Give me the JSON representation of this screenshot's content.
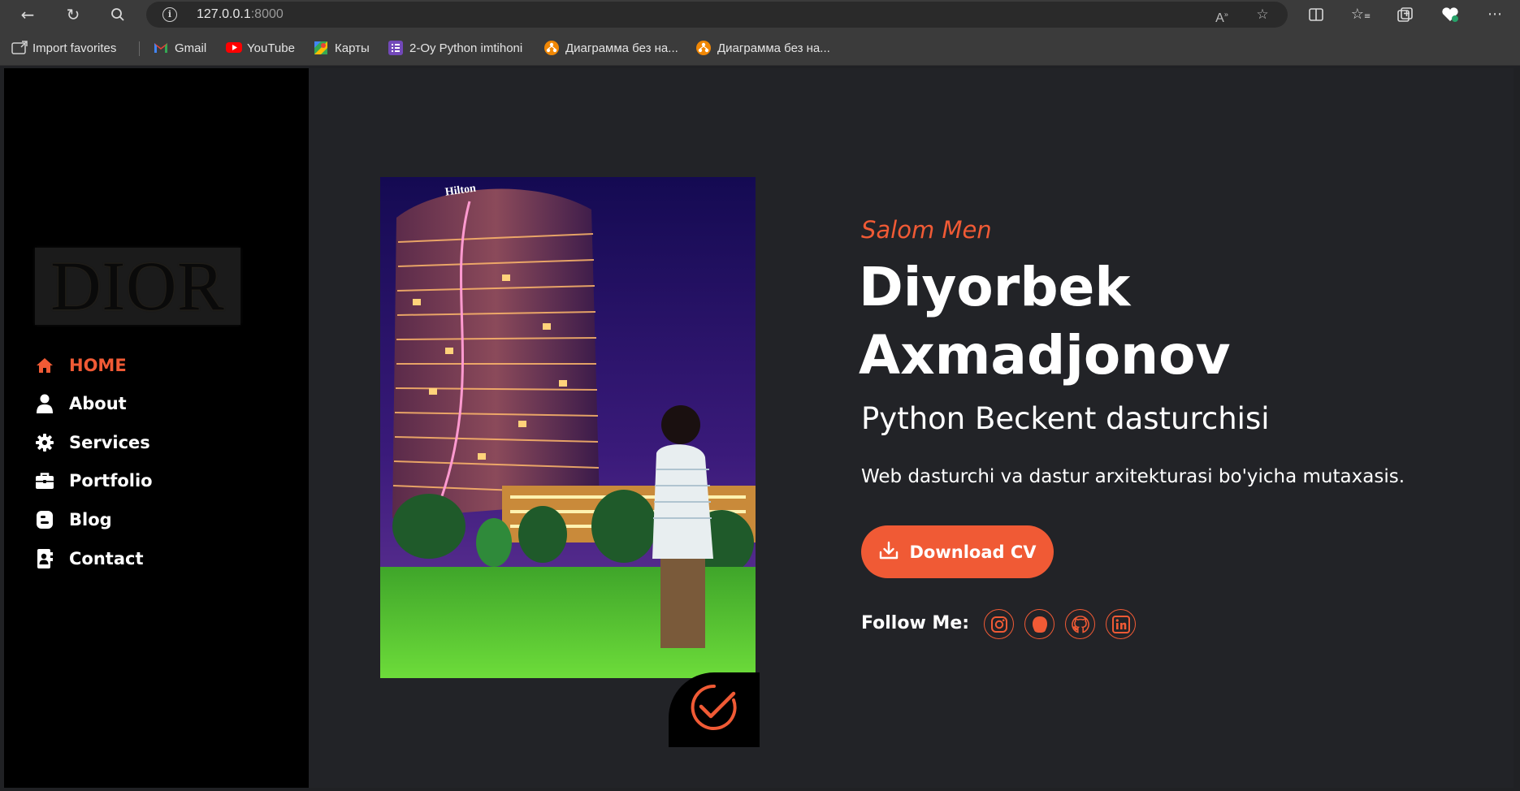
{
  "browser": {
    "url_host": "127.0.0.1",
    "url_port": ":8000",
    "bookmarks": [
      {
        "label": "Import favorites",
        "icon": "import-icon"
      },
      {
        "label": "Gmail",
        "icon": "gmail-icon"
      },
      {
        "label": "YouTube",
        "icon": "youtube-icon"
      },
      {
        "label": "Карты",
        "icon": "maps-icon"
      },
      {
        "label": "2-Oy Python imtihoni",
        "icon": "forms-icon"
      },
      {
        "label": "Диаграмма без на...",
        "icon": "diagram-icon"
      },
      {
        "label": "Диаграмма без на...",
        "icon": "diagram-icon"
      }
    ]
  },
  "sidebar": {
    "logo_text": "DIOR",
    "menu": [
      {
        "label": "HOME",
        "icon": "home-icon",
        "active": true
      },
      {
        "label": "About",
        "icon": "user-icon",
        "active": false
      },
      {
        "label": "Services",
        "icon": "gear-icon",
        "active": false
      },
      {
        "label": "Portfolio",
        "icon": "briefcase-icon",
        "active": false
      },
      {
        "label": "Blog",
        "icon": "blog-icon",
        "active": false
      },
      {
        "label": "Contact",
        "icon": "contact-card-icon",
        "active": false
      }
    ]
  },
  "hero": {
    "greeting": "Salom Men",
    "name_line1": "Diyorbek",
    "name_line2": "Axmadjonov",
    "role": "Python Beckent dasturchisi",
    "description": "Web dasturchi va dastur arxitekturasi bo'yicha mutaxasis.",
    "cta_label": "Download CV",
    "follow_label": "Follow Me:",
    "socials": [
      "instagram-icon",
      "threads-icon",
      "github-icon",
      "linkedin-icon"
    ],
    "photo_sign": "Hilton"
  },
  "colors": {
    "accent": "#f05a35",
    "page_bg": "#222327",
    "sidebar_bg": "#000000"
  }
}
